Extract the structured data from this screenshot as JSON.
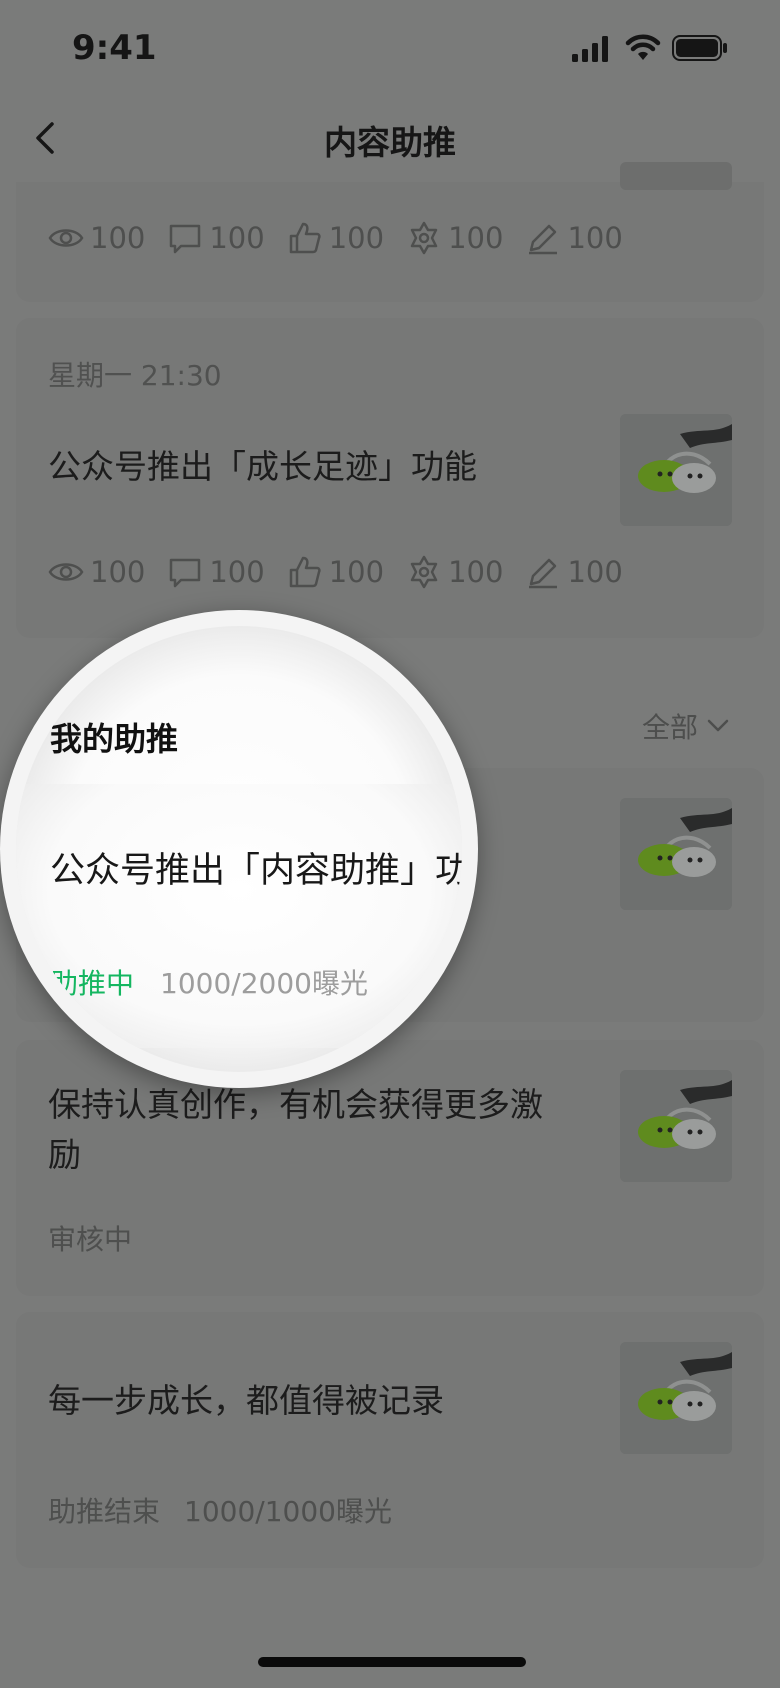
{
  "status_bar": {
    "time": "9:41"
  },
  "nav": {
    "title": "内容助推"
  },
  "top_card": {
    "stats": [
      "100",
      "100",
      "100",
      "100",
      "100"
    ]
  },
  "card_two": {
    "time_label": "星期一 21:30",
    "title": "公众号推出「成长足迹」功能",
    "stats": [
      "100",
      "100",
      "100",
      "100",
      "100"
    ]
  },
  "my_boost": {
    "section_title": "我的助推",
    "filter_label": "全部",
    "items": [
      {
        "title": "公众号推出「内容助推」功能",
        "status": "助推中",
        "exposure": "1000/2000曝光"
      },
      {
        "title_line1": "保持认真创作，有机会获得更多激",
        "title_line2": "励",
        "status": "审核中"
      },
      {
        "title": "每一步成长，都值得被记录",
        "status": "助推结束",
        "exposure": "1000/1000曝光"
      }
    ]
  },
  "colors": {
    "accent_green": "#14b660",
    "overlay_bg": "#7a7b7a"
  },
  "icons": [
    "eye-icon",
    "comment-icon",
    "thumbs-up-icon",
    "share-icon",
    "edit-icon",
    "chevron-down-icon",
    "back-icon"
  ]
}
